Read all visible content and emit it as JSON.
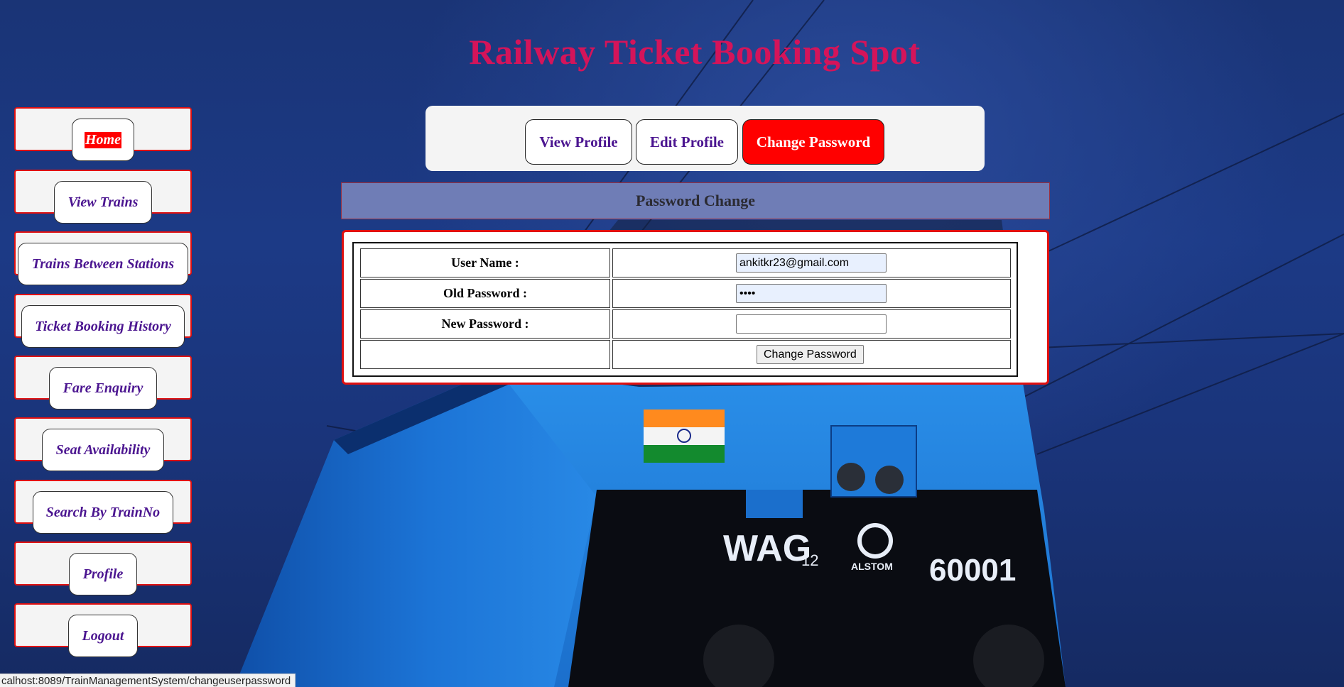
{
  "header": {
    "title": "Railway Ticket Booking Spot"
  },
  "sidebar": {
    "items": [
      {
        "label": "Home",
        "active": true
      },
      {
        "label": "View Trains"
      },
      {
        "label": "Trains Between Stations"
      },
      {
        "label": "Ticket Booking History"
      },
      {
        "label": "Fare Enquiry"
      },
      {
        "label": "Seat Availability"
      },
      {
        "label": "Search By TrainNo"
      },
      {
        "label": "Profile"
      },
      {
        "label": "Logout"
      }
    ]
  },
  "profile_tabs": [
    {
      "label": "View Profile"
    },
    {
      "label": "Edit Profile"
    },
    {
      "label": "Change Password",
      "active": true
    }
  ],
  "section": {
    "heading": "Password Change"
  },
  "form": {
    "username_label": "User Name :",
    "username_value": "ankitkr23@gmail.com",
    "old_password_label": "Old Password :",
    "old_password_value": "••••",
    "new_password_label": "New Password :",
    "new_password_value": "",
    "submit_label": "Change Password"
  },
  "status_bar": {
    "url": "calhost:8089/TrainManagementSystem/changeuserpassword"
  },
  "colors": {
    "title": "#d4145a",
    "accent_red": "#ff0000",
    "link_purple": "#4b1590",
    "heading_bar": "#6f7db6"
  }
}
